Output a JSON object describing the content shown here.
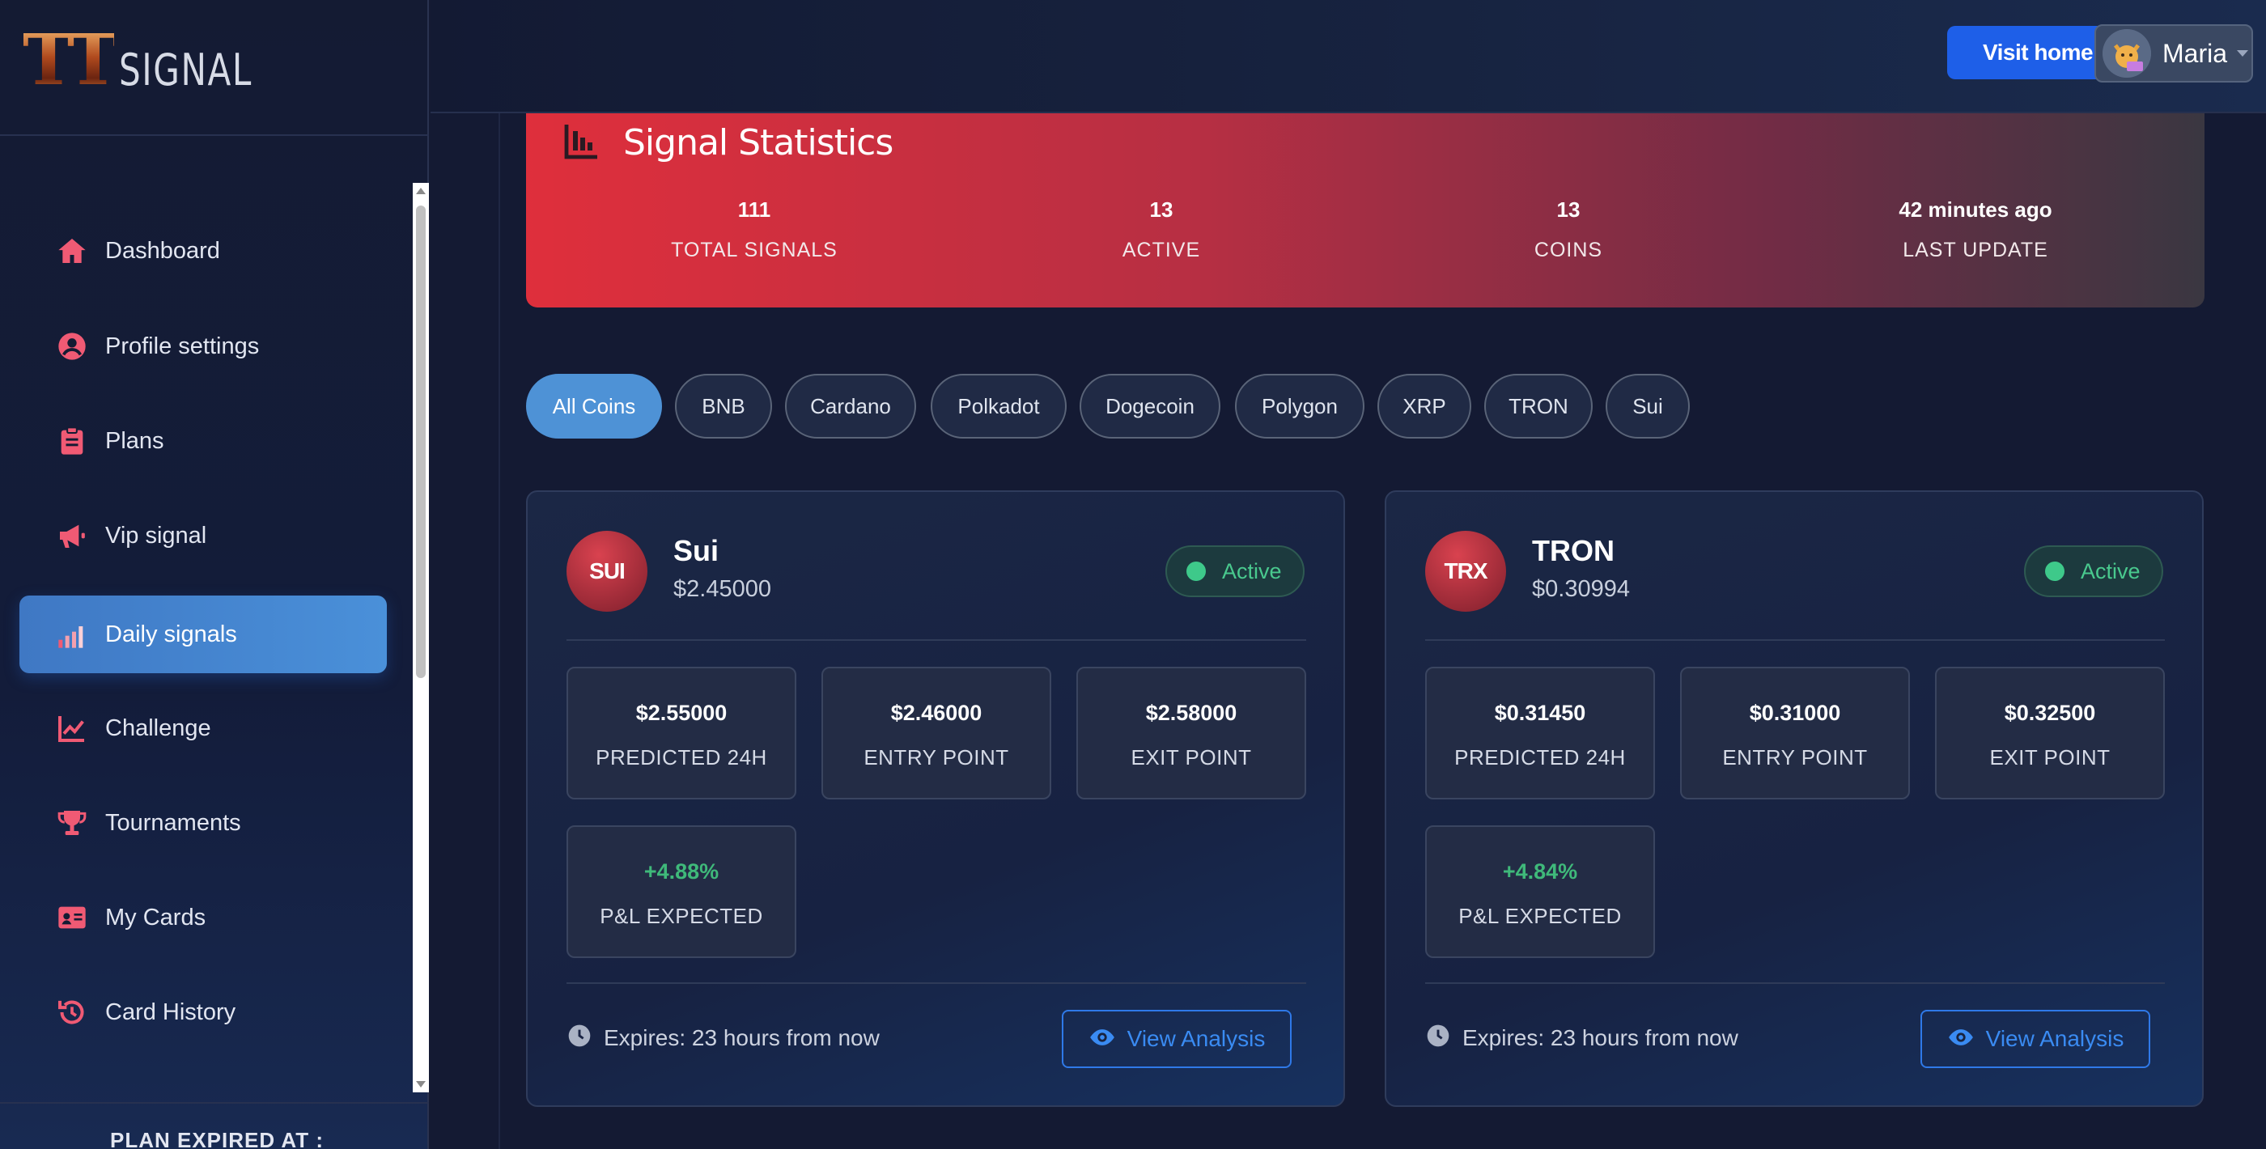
{
  "brand": {
    "logo_tt": "TT",
    "logo_signal": "SIGNAL"
  },
  "sidebar": {
    "items": [
      {
        "label": "Dashboard",
        "icon": "home-icon"
      },
      {
        "label": "Profile settings",
        "icon": "user-circle-icon"
      },
      {
        "label": "Plans",
        "icon": "clipboard-icon"
      },
      {
        "label": "Vip signal",
        "icon": "megaphone-icon"
      },
      {
        "label": "Daily signals",
        "icon": "signal-bars-icon",
        "active": true
      },
      {
        "label": "Challenge",
        "icon": "line-chart-icon"
      },
      {
        "label": "Tournaments",
        "icon": "trophy-icon"
      },
      {
        "label": "My Cards",
        "icon": "id-card-icon"
      },
      {
        "label": "Card History",
        "icon": "history-icon"
      }
    ],
    "plan_label": "PLAN EXPIRED AT :"
  },
  "header": {
    "visit_home": "Visit home",
    "user_name": "Maria"
  },
  "stats": {
    "title": "Signal Statistics",
    "items": [
      {
        "value": "111",
        "label": "TOTAL SIGNALS"
      },
      {
        "value": "13",
        "label": "ACTIVE"
      },
      {
        "value": "13",
        "label": "COINS"
      },
      {
        "value": "42 minutes ago",
        "label": "LAST UPDATE"
      }
    ]
  },
  "filters": [
    "All Coins",
    "BNB",
    "Cardano",
    "Polkadot",
    "Dogecoin",
    "Polygon",
    "XRP",
    "TRON",
    "Sui"
  ],
  "cards": [
    {
      "symbol": "SUI",
      "name": "Sui",
      "price": "$2.45000",
      "status": "Active",
      "metrics": [
        {
          "value": "$2.55000",
          "label": "PREDICTED 24H"
        },
        {
          "value": "$2.46000",
          "label": "ENTRY POINT"
        },
        {
          "value": "$2.58000",
          "label": "EXIT POINT"
        },
        {
          "value": "+4.88%",
          "label": "P&L EXPECTED"
        }
      ],
      "expires": "Expires: 23 hours from now",
      "action": "View Analysis"
    },
    {
      "symbol": "TRX",
      "name": "TRON",
      "price": "$0.30994",
      "status": "Active",
      "metrics": [
        {
          "value": "$0.31450",
          "label": "PREDICTED 24H"
        },
        {
          "value": "$0.31000",
          "label": "ENTRY POINT"
        },
        {
          "value": "$0.32500",
          "label": "EXIT POINT"
        },
        {
          "value": "+4.84%",
          "label": "P&L EXPECTED"
        }
      ],
      "expires": "Expires: 23 hours from now",
      "action": "View Analysis"
    }
  ],
  "colors": {
    "accent": "#4e92d6",
    "visit_home": "#1e5fe8",
    "active_green": "#3ec98a",
    "stats_red": "#df2f3c",
    "icon_pink": "#f05a74"
  }
}
